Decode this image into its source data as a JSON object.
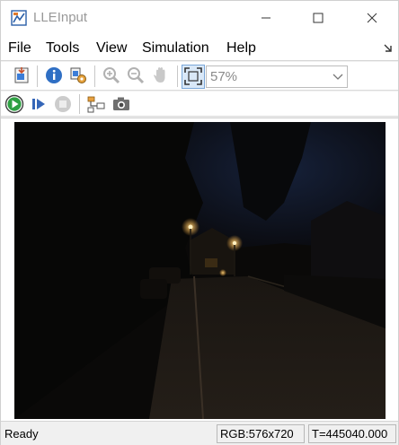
{
  "window": {
    "title": "LLEInput"
  },
  "menu": {
    "items": [
      "File",
      "Tools",
      "View",
      "Simulation",
      "Help"
    ]
  },
  "toolbar": {
    "zoom_value": "57%",
    "icons": [
      "import-icon",
      "info-icon",
      "settings-icon",
      "zoom-in-icon",
      "zoom-out-icon",
      "pan-icon",
      "fit-to-window-icon"
    ]
  },
  "playback": {
    "icons": [
      "run-icon",
      "step-forward-icon",
      "stop-icon",
      "highlight-model-icon",
      "snapshot-icon"
    ]
  },
  "video": {
    "description_icon": "night-street-scene"
  },
  "status": {
    "ready": "Ready",
    "format": "RGB:576x720",
    "time": "T=445040.000"
  },
  "colors": {
    "accent": "#1e73c9",
    "run_green": "#2ea043",
    "video_bg": "#0c0b09"
  }
}
